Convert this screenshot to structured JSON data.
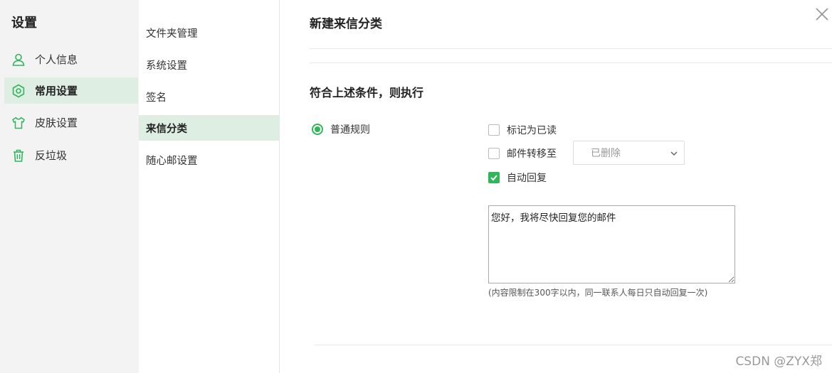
{
  "sidebar": {
    "title": "设置",
    "items": [
      {
        "label": "个人信息",
        "icon": "user-icon"
      },
      {
        "label": "常用设置",
        "icon": "gear-icon",
        "active": true
      },
      {
        "label": "皮肤设置",
        "icon": "shirt-icon"
      },
      {
        "label": "反垃圾",
        "icon": "trash-icon"
      }
    ]
  },
  "submenu": {
    "items": [
      {
        "label": "文件夹管理"
      },
      {
        "label": "系统设置"
      },
      {
        "label": "签名"
      },
      {
        "label": "来信分类",
        "active": true
      },
      {
        "label": "随心邮设置"
      }
    ]
  },
  "panel": {
    "title": "新建来信分类",
    "section_title": "符合上述条件，则执行",
    "radio_label": "普通规则",
    "actions": {
      "mark_read": "标记为已读",
      "move_to": "邮件转移至",
      "auto_reply": "自动回复"
    },
    "folder_select": {
      "value": "已删除"
    },
    "reply_text": "您好，我将尽快回复您的邮件",
    "hint": "(内容限制在300字以内，同一联系人每日只自动回复一次)"
  },
  "watermark": "CSDN @ZYX郑",
  "colors": {
    "accent": "#2fb55a",
    "active_bg": "#dfeee3",
    "sidebar_bg": "#f3f3f3"
  }
}
